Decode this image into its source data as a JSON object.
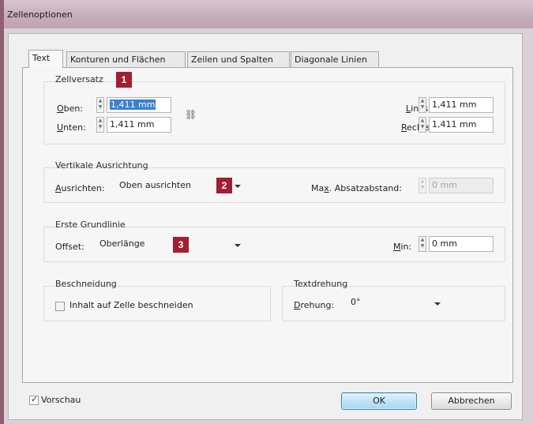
{
  "window": {
    "title": "Zellenoptionen"
  },
  "tabs": [
    "Text",
    "Konturen und Flächen",
    "Zeilen und Spalten",
    "Diagonale Linien"
  ],
  "zellversatz": {
    "title": "Zellversatz",
    "badge": "1",
    "oben": {
      "label_u": "O",
      "label_rest": "ben:",
      "value": "1,411 mm"
    },
    "unten": {
      "label_u": "U",
      "label_rest": "nten:",
      "value": "1,411 mm"
    },
    "links": {
      "label_u": "L",
      "label_rest": "inks:",
      "value": "1,411 mm"
    },
    "rechts": {
      "label_u": "R",
      "label_rest": "echts:",
      "value": "1,411 mm"
    }
  },
  "vertikal": {
    "title": "Vertikale Ausrichtung",
    "badge": "2",
    "ausrichten": {
      "label_u": "A",
      "label_rest": "usrichten:",
      "value": "Oben ausrichten"
    },
    "max": {
      "label_pre": "Ma",
      "label_u": "x",
      "label_rest": ". Absatzabstand:",
      "value": "0 mm"
    }
  },
  "grundlinie": {
    "title": "Erste Grundlinie",
    "badge": "3",
    "offset": {
      "label_pre": "Of",
      "label_u": "f",
      "label_rest": "set:",
      "value": "Oberlänge"
    },
    "min": {
      "label_u": "M",
      "label_rest": "in:",
      "value": "0 mm"
    }
  },
  "beschneidung": {
    "title": "Beschneidung",
    "checkbox_label": "Inhalt auf Zelle beschneiden",
    "checked": false
  },
  "textdrehung": {
    "title": "Textdrehung",
    "drehung": {
      "label_u": "D",
      "label_rest": "rehung:",
      "value": "0°"
    }
  },
  "footer": {
    "vorschau_label": "Vorschau",
    "vorschau_checked": true,
    "ok_label": "OK",
    "cancel_label": "Abbrechen"
  },
  "colors": {
    "badge": "#a21f30",
    "selection": "#3b7fd0",
    "titlebar": "#c7adbb"
  }
}
